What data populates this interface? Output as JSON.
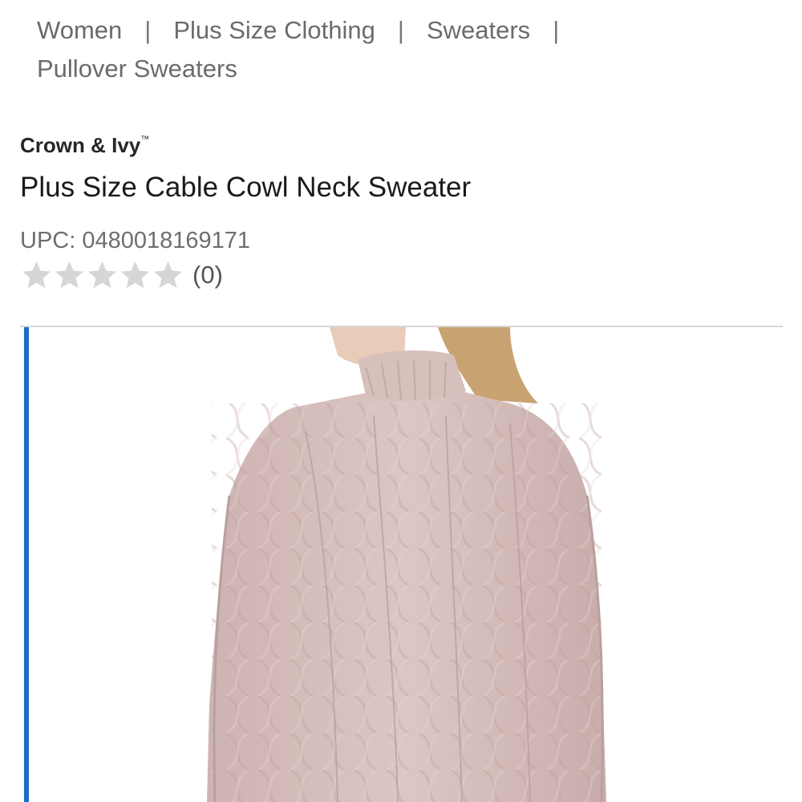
{
  "breadcrumb": {
    "items": [
      "Women",
      "Plus Size Clothing",
      "Sweaters",
      "Pullover Sweaters"
    ],
    "separator": "|"
  },
  "product": {
    "brand": "Crown & Ivy",
    "brand_mark": "™",
    "title": "Plus Size Cable Cowl Neck Sweater",
    "upc": "UPC: 0480018169171",
    "rating": {
      "value": 0,
      "max": 5,
      "review_count": "(0)"
    }
  },
  "gallery": {
    "image_icon": "product-photo-sweater",
    "indicator_color": "#1a6fc4",
    "sweater_color": "#d9c2c0",
    "hair_color": "#c9a272"
  },
  "colors": {
    "star_empty": "#d6d6d6",
    "text_muted": "#6b6b6b"
  }
}
